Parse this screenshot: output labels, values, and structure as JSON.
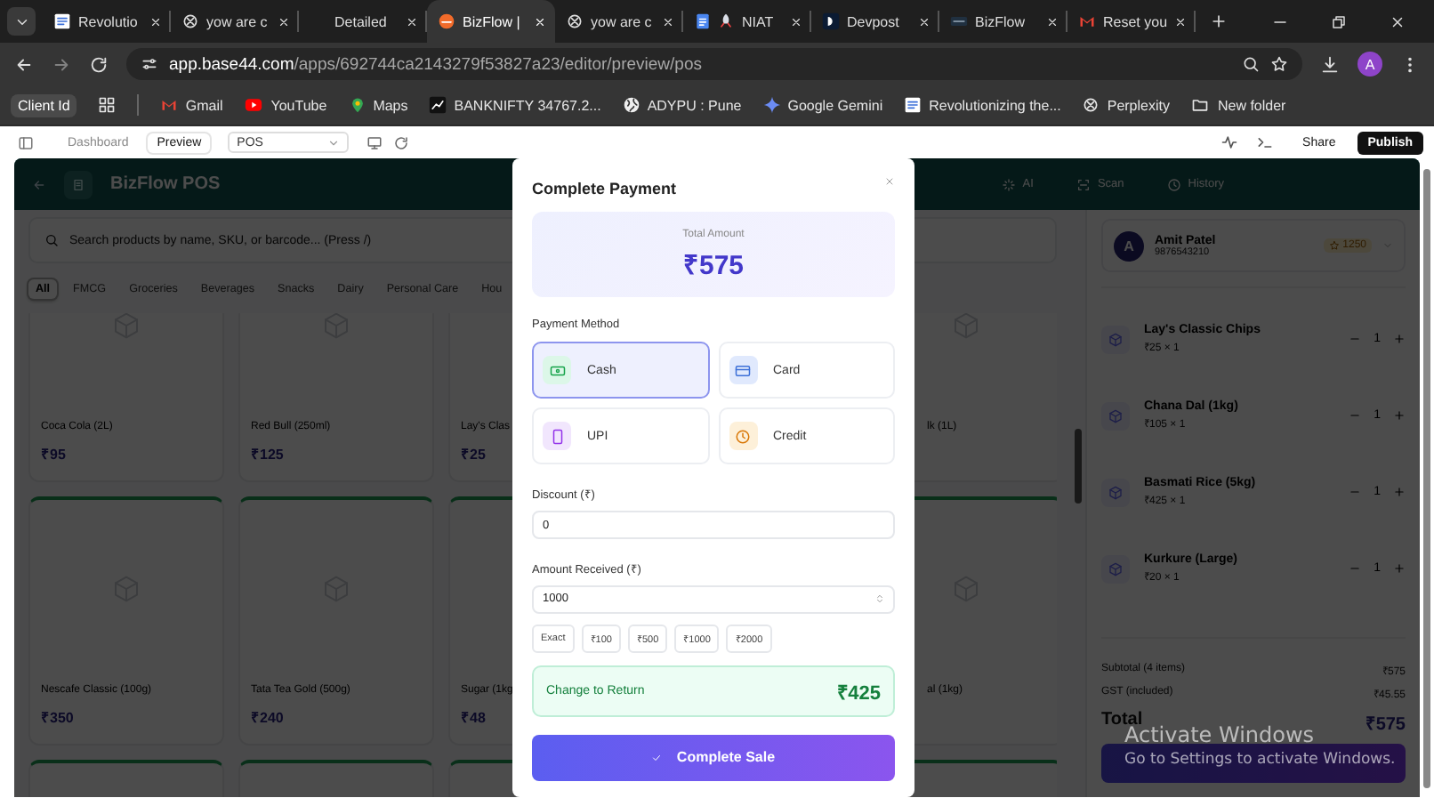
{
  "browser": {
    "tabs": [
      {
        "title": "Revolutio",
        "kind": "doc",
        "selected": false
      },
      {
        "title": "yow are c",
        "kind": "ai",
        "selected": false
      },
      {
        "title": "Detailed",
        "kind": "blank",
        "selected": false
      },
      {
        "title": "BizFlow |",
        "kind": "orange",
        "selected": true
      },
      {
        "title": "yow are c",
        "kind": "ai",
        "selected": false
      },
      {
        "title": "NIAT",
        "kind": "docs-rocket",
        "selected": false
      },
      {
        "title": "Devpost",
        "kind": "letter-d",
        "selected": false
      },
      {
        "title": "BizFlow",
        "kind": "dark",
        "selected": false
      },
      {
        "title": "Reset you",
        "kind": "mail",
        "selected": false
      }
    ],
    "address": {
      "host": "app.base44.com",
      "path": "/apps/692744ca2143279f53827a23/editor/preview/pos"
    },
    "profile": "A",
    "bookmarks": [
      {
        "label": "Client Id",
        "kind": "chip"
      },
      {
        "label": "Gmail",
        "kind": "mail"
      },
      {
        "label": "YouTube",
        "kind": "play"
      },
      {
        "label": "Maps",
        "kind": "pin"
      },
      {
        "label": "BANKNIFTY 34767.2...",
        "kind": "tv"
      },
      {
        "label": "ADYPU : Pune",
        "kind": "globe"
      },
      {
        "label": "Google Gemini",
        "kind": "spark"
      },
      {
        "label": "Revolutionizing the...",
        "kind": "doc"
      },
      {
        "label": "Perplexity",
        "kind": "ai"
      },
      {
        "label": "New folder",
        "kind": "folder"
      }
    ]
  },
  "editor": {
    "modes": [
      {
        "label": "Dashboard",
        "selected": false
      },
      {
        "label": "Preview",
        "selected": true
      }
    ],
    "page": "POS",
    "actions": [
      {
        "label": "Share",
        "kind": "plain"
      },
      {
        "label": "Publish",
        "kind": "primary"
      }
    ]
  },
  "app": {
    "title": "BizFlow POS",
    "header_actions": [
      {
        "label": "AI",
        "kind": "sparkle"
      },
      {
        "label": "Scan",
        "kind": "scan"
      },
      {
        "label": "History",
        "kind": "clock"
      }
    ],
    "search": {
      "placeholder": "Search products by name, SKU, or barcode... (Press /)"
    },
    "categories": [
      {
        "label": "All",
        "selected": true
      },
      {
        "label": "FMCG",
        "selected": false
      },
      {
        "label": "Groceries",
        "selected": false
      },
      {
        "label": "Beverages",
        "selected": false
      },
      {
        "label": "Snacks",
        "selected": false
      },
      {
        "label": "Dairy",
        "selected": false
      },
      {
        "label": "Personal Care",
        "selected": false
      },
      {
        "label": "Hou",
        "selected": false
      }
    ],
    "product_rows": [
      {
        "items": [
          {
            "name": "Coca Cola (2L)",
            "price": "₹95"
          },
          {
            "name": "Red Bull (250ml)",
            "price": "₹125"
          },
          {
            "name": "Lay's Clas",
            "price": "₹25"
          }
        ],
        "right_item": {
          "name": "lk (1L)"
        }
      },
      {
        "items": [
          {
            "name": "Nescafe Classic (100g)",
            "price": "₹350"
          },
          {
            "name": "Tata Tea Gold (500g)",
            "price": "₹240"
          },
          {
            "name": "Sugar (1kg",
            "price": "₹48"
          }
        ],
        "right_item": {
          "name": "al (1kg)"
        }
      }
    ],
    "customer": {
      "initial": "A",
      "name": "Amit Patel",
      "phone": "9876543210",
      "points": "1250"
    },
    "cart": [
      {
        "name": "Lay's Classic Chips",
        "line": "₹25 × 1",
        "qty": "1"
      },
      {
        "name": "Chana Dal (1kg)",
        "line": "₹105 × 1",
        "qty": "1"
      },
      {
        "name": "Basmati Rice (5kg)",
        "line": "₹425 × 1",
        "qty": "1"
      },
      {
        "name": "Kurkure (Large)",
        "line": "₹20 × 1",
        "qty": "1"
      }
    ],
    "summary": [
      {
        "label": "Subtotal (4 items)",
        "value": "₹575"
      },
      {
        "label": "GST (included)",
        "value": "₹45.55"
      }
    ],
    "total": {
      "label": "Total",
      "value": "₹575"
    }
  },
  "dialog": {
    "title": "Complete Payment",
    "total_label": "Total Amount",
    "total": "₹575",
    "method_label": "Payment Method",
    "methods": [
      {
        "label": "Cash",
        "kind": "cash",
        "selected": true
      },
      {
        "label": "Card",
        "kind": "card",
        "selected": false
      },
      {
        "label": "UPI",
        "kind": "upi",
        "selected": false
      },
      {
        "label": "Credit",
        "kind": "credit",
        "selected": false
      }
    ],
    "discount": {
      "label": "Discount (₹)",
      "value": "0"
    },
    "received": {
      "label": "Amount Received (₹)",
      "value": "1000"
    },
    "quick_amounts": [
      "Exact",
      "₹100",
      "₹500",
      "₹1000",
      "₹2000"
    ],
    "change": {
      "label": "Change to Return",
      "value": "₹425"
    },
    "submit": "Complete Sale"
  },
  "windows_notice": {
    "title": "Activate Windows",
    "message": "Go to Settings to activate Windows."
  }
}
